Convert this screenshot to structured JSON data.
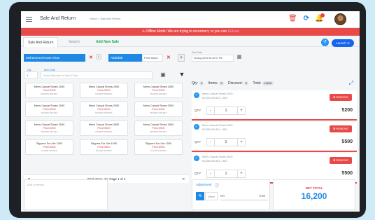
{
  "header": {
    "title": "Sale And Return",
    "breadcrumb": "Home  >  Sale And Return"
  },
  "banner": {
    "text": "Offline Mode: We are trying to reconnect, or you can ",
    "link": "Reload"
  },
  "tabs": [
    {
      "label": "Sale And Return"
    },
    {
      "label": "Search"
    },
    {
      "label": "Add New Sale"
    }
  ],
  "actions": {
    "reset": "↺",
    "launch": "Launch ⊙"
  },
  "customer": {
    "name": "Mohammed Imran Khan",
    "salesperson": "Abdullah",
    "salesperson_extra": "Price Band",
    "date_label": "Sale Date",
    "date": "16-Aug-2021 06:42:07 PM"
  },
  "search": {
    "label": "Qty",
    "value": "1",
    "code_label": "Item Code",
    "code_placeholder": "Scan Barcode or Item Code"
  },
  "products": [
    {
      "name": "Mens Casual Shoes 2000",
      "price": "Price:5200",
      "code": "MC2000-SIM-BLK"
    },
    {
      "name": "Mens Casual Shoes 2000",
      "price": "Price:5200",
      "code": "MC2000-SIM-BLK"
    },
    {
      "name": "Mens Casual Shoes 2000",
      "price": "Price:5200",
      "code": "MC2000-SIM-BLK"
    },
    {
      "name": "Mens Casual Shoes 2000",
      "price": "Price:5200",
      "code": "MC2000-SIM-BLK"
    },
    {
      "name": "Mens Casual Shoes 2000",
      "price": "Price:5200",
      "code": "MC2000-SIM-BLK"
    },
    {
      "name": "Mens Casual Shoes 2000",
      "price": "Price:5200",
      "code": "MC2000-SIM-BLK"
    },
    {
      "name": "Mens Casual Shoes 3000",
      "price": "Price:5500",
      "code": "MC3000-SIM-BLK"
    },
    {
      "name": "Mens Casual Shoes 3000",
      "price": "Price:5500",
      "code": "MC3000-SIM-BLK"
    },
    {
      "name": "Mens Casual Shoes 3000",
      "price": "Price:5500",
      "code": "MC3000-SIM-BLK"
    },
    {
      "name": "Slippers For Life 1000",
      "price": "Price:5500",
      "code": "SL1000-SIM-BLK"
    },
    {
      "name": "Slippers For Life 1000",
      "price": "Price:5500",
      "code": "SL1000-SIM-BLK"
    },
    {
      "name": "Slippers For Life 1000",
      "price": "Price:5500",
      "code": "SL1000-SIM-BLK"
    }
  ],
  "pager": {
    "text": "Total Items: 34, Page 1 of 4",
    "prev": "«",
    "next": "»"
  },
  "summary": {
    "qty_label": "Qty:",
    "qty": "3",
    "items_label": "Items:",
    "items": "3",
    "discount_label": "Discount:",
    "discount": "0",
    "total_label": "Total:",
    "total": "16200"
  },
  "cart": [
    {
      "name": "Mens Casual Shoes 2000",
      "code": "MC2000-SIM-BLK  -  5200",
      "remove": "✖ REMOVE",
      "qty_label": "QTY",
      "qty": "1",
      "total": "5200"
    },
    {
      "name": "Mens Casual Shoes 3000",
      "code": "MC3000-SIM-BLK  -  5500",
      "remove": "✖ REMOVE",
      "qty_label": "QTY",
      "qty": "1",
      "total": "5500"
    },
    {
      "name": "Mens Casual Shoes 3000",
      "code": "MC3000-SIM-BLK  -  5500",
      "remove": "✖ REMOVE",
      "qty_label": "QTY",
      "qty": "1",
      "total": "5500"
    }
  ],
  "remarks": {
    "placeholder": "Add a remark"
  },
  "adjustment": {
    "label": "Adjustment",
    "pct": "%",
    "value_btn": "Value",
    "value_placeholder": "NA",
    "amount": "0.00"
  },
  "net_total": {
    "label": "NET TOTAL",
    "value": "16,200"
  }
}
